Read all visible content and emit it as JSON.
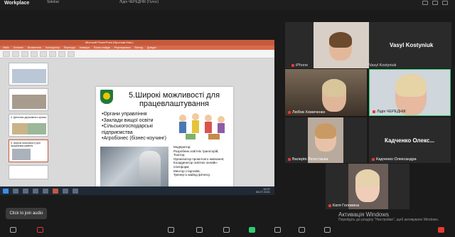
{
  "app": {
    "title": "Workplace",
    "top_items": [
      "Sidebar",
      "Лідія ЧЕРЕДНІК (Голос)",
      "",
      ""
    ]
  },
  "ppt": {
    "window_title": "Microsoft PowerPoint (Ярослав Mad.)",
    "tabs": [
      "Файл",
      "Основне",
      "Вставлення",
      "Конструктор",
      "Переходи",
      "Анімація",
      "Показ слайдів",
      "Рецензування",
      "Вигляд",
      "Довідка"
    ],
    "thumbnails": [
      {
        "num": "4",
        "title": ""
      },
      {
        "num": "5",
        "title": ""
      },
      {
        "num": "6",
        "title": "4. Дипломи державного зразка"
      },
      {
        "num": "7",
        "title": "5. Широкі можливості для працевлаштування"
      },
      {
        "num": "8",
        "title": ""
      }
    ],
    "slide": {
      "title": "5.Широкі можливості для працевлаштування",
      "bullets": [
        "•Органи управління",
        "•Заклади вищої освіти",
        "•Сільськогосподарські підприємства",
        "•Агробізнес (бізнес-коучинг)"
      ],
      "roles": [
        "Модератор;",
        "Розробник освітніх траєкторій;",
        "Тьютор;",
        "Організатор проектного навчання;",
        "Координатор освітніх онлайн-платформ;",
        "Ментор стартапів;",
        "Тренер із майнд фітнесу."
      ]
    },
    "notes_placeholder": "Нотатки до слайда",
    "clock": "10:37",
    "date": "08.07.2021"
  },
  "participants": {
    "vasyl": {
      "big_name": "Vasyl Kostyniuk",
      "label": "Vasyl Kostyniuk"
    },
    "iphone": {
      "label": "iPhone"
    },
    "lyubov": {
      "label": "Любов Хомиченко"
    },
    "lidiia": {
      "label": "Лідія ЧЕРЕДНІК"
    },
    "valeriia": {
      "label": "Валерія Легостаєва"
    },
    "kadchenko": {
      "big_name": "Кадченко Олекс...",
      "label": "Кадченко Олександра"
    },
    "katia": {
      "label": "Катя Головина"
    }
  },
  "hint": "Click to join audio",
  "activation": {
    "heading": "Активація Windows",
    "sub": "Перейдіть до розділу \"Настройки\", щоб активувати Windows."
  },
  "colors": {
    "accent": "#c55a3b",
    "active_speaker": "#2ecc71",
    "muted": "#e53935"
  }
}
